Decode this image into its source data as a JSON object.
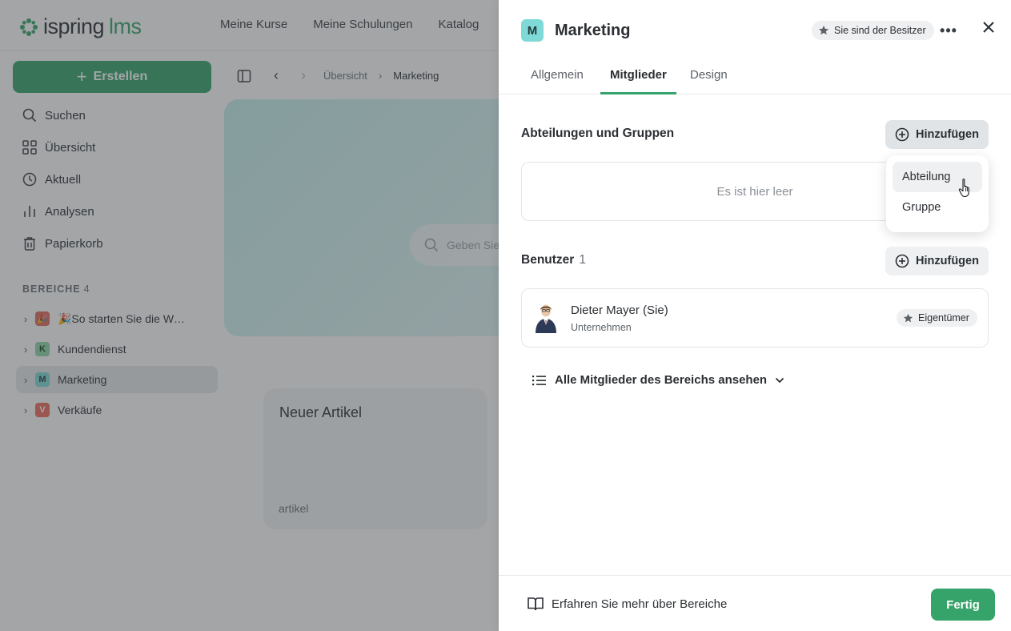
{
  "app": {
    "logo_brand": "ispring",
    "logo_suffix": "lms",
    "top_nav": [
      "Meine Kurse",
      "Meine Schulungen",
      "Katalog"
    ],
    "create_label": "Erstellen",
    "sidebar_nav": [
      {
        "label": "Suchen",
        "icon": "search-icon"
      },
      {
        "label": "Übersicht",
        "icon": "grid-icon"
      },
      {
        "label": "Aktuell",
        "icon": "clock-icon"
      },
      {
        "label": "Analysen",
        "icon": "bar-chart-icon"
      },
      {
        "label": "Papierkorb",
        "icon": "trash-icon"
      }
    ],
    "spaces_title": "BEREICHE",
    "spaces_count": "4",
    "spaces": [
      {
        "label": "🎉So starten Sie die W…",
        "badge": "🎉",
        "color": "#e06b5b"
      },
      {
        "label": "Kundendienst",
        "badge": "K",
        "color": "#8fd8a6"
      },
      {
        "label": "Marketing",
        "badge": "M",
        "color": "#7fd9d6"
      },
      {
        "label": "Verkäufe",
        "badge": "V",
        "color": "#ef6b5a"
      }
    ],
    "breadcrumb": [
      "Übersicht",
      "Marketing"
    ],
    "hero_search_placeholder": "Geben Sie",
    "card": {
      "title": "Neuer Artikel",
      "type": "artikel"
    }
  },
  "panel": {
    "badge": "M",
    "title": "Marketing",
    "owner_chip": "Sie sind der Besitzer",
    "tabs": [
      "Allgemein",
      "Mitglieder",
      "Design"
    ],
    "active_tab": "Mitglieder",
    "groups": {
      "title": "Abteilungen und Gruppen",
      "add_label": "Hinzufügen",
      "empty_text": "Es ist hier leer",
      "dropdown": [
        "Abteilung",
        "Gruppe"
      ]
    },
    "users": {
      "title": "Benutzer",
      "count": "1",
      "add_label": "Hinzufügen",
      "list": [
        {
          "name": "Dieter Mayer (Sie)",
          "org": "Unternehmen",
          "role": "Eigentümer"
        }
      ]
    },
    "all_members_label": "Alle Mitglieder des Bereichs ansehen",
    "learn_more": "Erfahren Sie mehr über Bereiche",
    "done_label": "Fertig"
  },
  "colors": {
    "accent": "#36a46a",
    "badge_marketing": "#7fd9d6",
    "overlay": "rgba(60,64,68,0.47)"
  }
}
